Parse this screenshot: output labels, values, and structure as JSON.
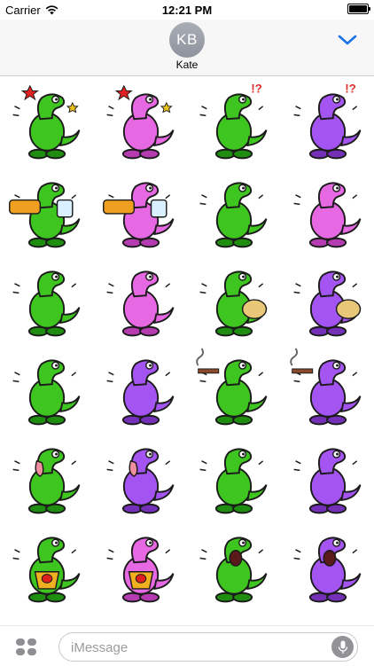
{
  "status_bar": {
    "carrier": "Carrier",
    "time": "12:21 PM"
  },
  "header": {
    "avatar_initials": "KB",
    "contact_name": "Kate"
  },
  "sticker_pack": {
    "columns": 4,
    "rows": 6,
    "colors": {
      "green": "#3ec51f",
      "green_dark": "#1f8d10",
      "pink": "#e668e2",
      "pink_dark": "#b53bb1",
      "purple": "#a454f0",
      "purple_dark": "#7431b8"
    },
    "stickers": [
      {
        "name": "sticker-dizzy-green",
        "icon": "dizzy-dinosaur-icon",
        "color": "green"
      },
      {
        "name": "sticker-dizzy-pink",
        "icon": "dizzy-dinosaur-icon",
        "color": "pink"
      },
      {
        "name": "sticker-confused-green",
        "icon": "confused-dinosaur-icon",
        "color": "green"
      },
      {
        "name": "sticker-confused-purple",
        "icon": "confused-dinosaur-icon",
        "color": "purple"
      },
      {
        "name": "sticker-burp-green",
        "icon": "burp-dinosaur-icon",
        "color": "green"
      },
      {
        "name": "sticker-burp-pink",
        "icon": "burp-dinosaur-icon",
        "color": "pink"
      },
      {
        "name": "sticker-thinking-green",
        "icon": "thinking-dinosaur-icon",
        "color": "green"
      },
      {
        "name": "sticker-thinking-pink",
        "icon": "thinking-dinosaur-icon",
        "color": "pink"
      },
      {
        "name": "sticker-facepalm-green",
        "icon": "facepalm-dinosaur-icon",
        "color": "green"
      },
      {
        "name": "sticker-facepalm-pink",
        "icon": "facepalm-dinosaur-icon",
        "color": "pink"
      },
      {
        "name": "sticker-fart-green",
        "icon": "fart-dinosaur-icon",
        "color": "green"
      },
      {
        "name": "sticker-fart-purple",
        "icon": "fart-dinosaur-icon",
        "color": "purple"
      },
      {
        "name": "sticker-laughing-green",
        "icon": "laughing-dinosaur-icon",
        "color": "green"
      },
      {
        "name": "sticker-laughing-purple",
        "icon": "laughing-dinosaur-icon",
        "color": "purple"
      },
      {
        "name": "sticker-smoking-green",
        "icon": "smoking-dinosaur-icon",
        "color": "green"
      },
      {
        "name": "sticker-smoking-purple",
        "icon": "smoking-dinosaur-icon",
        "color": "purple"
      },
      {
        "name": "sticker-tongue-green",
        "icon": "tongue-dinosaur-icon",
        "color": "green"
      },
      {
        "name": "sticker-tongue-purple",
        "icon": "tongue-dinosaur-icon",
        "color": "purple"
      },
      {
        "name": "sticker-shy-green",
        "icon": "shy-dinosaur-icon",
        "color": "green"
      },
      {
        "name": "sticker-shy-purple",
        "icon": "shy-dinosaur-icon",
        "color": "purple"
      },
      {
        "name": "sticker-angry-green",
        "icon": "angry-dinosaur-icon",
        "color": "green"
      },
      {
        "name": "sticker-angry-pink",
        "icon": "angry-dinosaur-icon",
        "color": "pink"
      },
      {
        "name": "sticker-scream-green",
        "icon": "scream-dinosaur-icon",
        "color": "green"
      },
      {
        "name": "sticker-scream-purple",
        "icon": "scream-dinosaur-icon",
        "color": "purple"
      }
    ]
  },
  "input_bar": {
    "placeholder": "iMessage"
  },
  "accent_color": "#1a73e8"
}
